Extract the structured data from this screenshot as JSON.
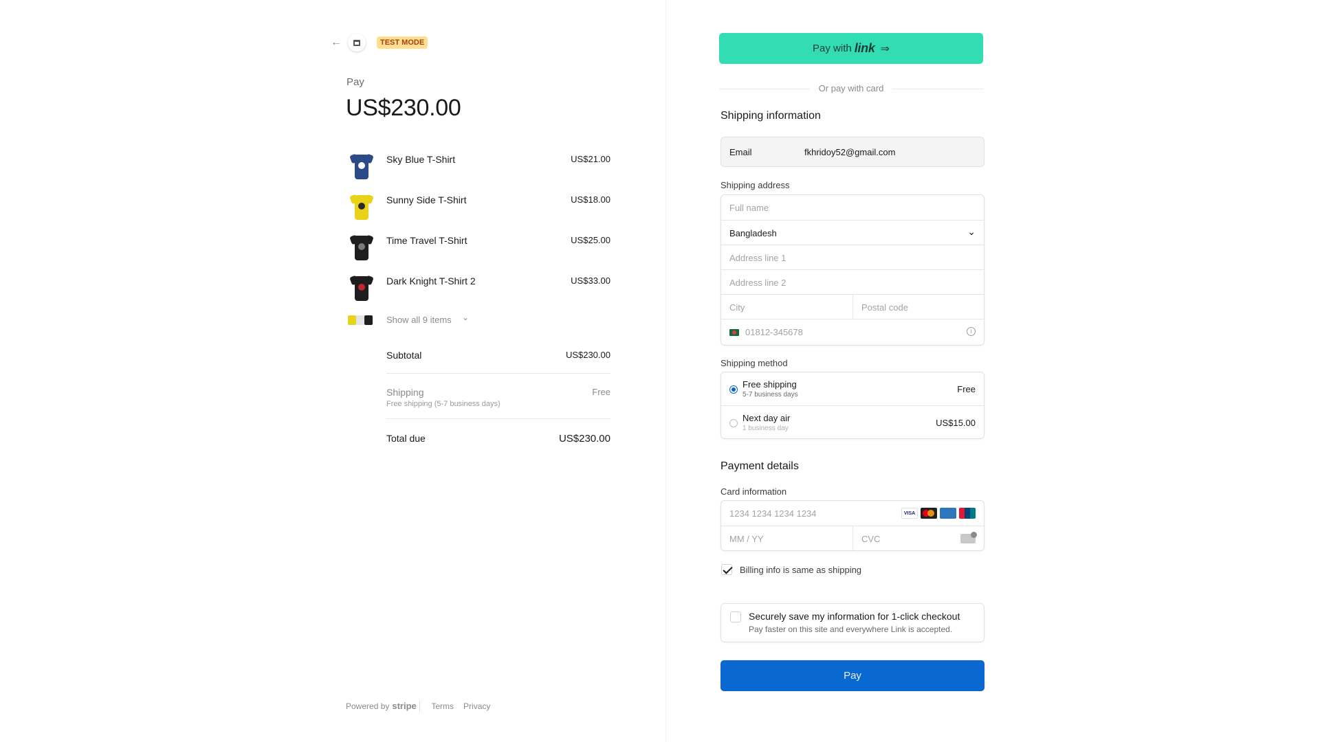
{
  "header": {
    "back_icon": "arrow-left-icon",
    "store_icon": "store-icon",
    "test_badge": "TEST MODE"
  },
  "summary": {
    "pay_label": "Pay",
    "amount": "US$230.00",
    "items": [
      {
        "name": "Sky Blue T-Shirt",
        "price": "US$21.00",
        "color": "#2c4a8a",
        "print": "#ffffff"
      },
      {
        "name": "Sunny Side T-Shirt",
        "price": "US$18.00",
        "color": "#e8d21a",
        "print": "#2a2a2a"
      },
      {
        "name": "Time Travel T-Shirt",
        "price": "US$25.00",
        "color": "#1e1e1e",
        "print": "#7a7a7a"
      },
      {
        "name": "Dark Knight T-Shirt 2",
        "price": "US$33.00",
        "color": "#1e1e1e",
        "print": "#c0282d"
      }
    ],
    "show_all": "Show all 9 items",
    "subtotal_label": "Subtotal",
    "subtotal_value": "US$230.00",
    "shipping_label": "Shipping",
    "shipping_sub": "Free shipping (5-7 business days)",
    "shipping_value": "Free",
    "total_label": "Total due",
    "total_value": "US$230.00"
  },
  "footer": {
    "powered_by": "Powered by",
    "brand": "stripe",
    "terms": "Terms",
    "privacy": "Privacy"
  },
  "checkout": {
    "link_button_prefix": "Pay with",
    "link_button_brand": "link",
    "or_text": "Or pay with card",
    "shipping_info_title": "Shipping information",
    "email_label": "Email",
    "email_value": "fkhridoy52@gmail.com",
    "shipping_address_label": "Shipping address",
    "full_name_placeholder": "Full name",
    "country_value": "Bangladesh",
    "address1_placeholder": "Address line 1",
    "address2_placeholder": "Address line 2",
    "city_placeholder": "City",
    "postal_placeholder": "Postal code",
    "phone_placeholder": "01812-345678",
    "shipping_method_label": "Shipping method",
    "shipping_methods": [
      {
        "title": "Free shipping",
        "sub": "5-7 business days",
        "price": "Free",
        "selected": true
      },
      {
        "title": "Next day air",
        "sub": "1 business day",
        "price": "US$15.00",
        "selected": false
      }
    ],
    "payment_details_title": "Payment details",
    "card_info_label": "Card information",
    "card_number_placeholder": "1234 1234 1234 1234",
    "expiry_placeholder": "MM / YY",
    "cvc_placeholder": "CVC",
    "card_brands": [
      "VISA",
      "MC",
      "AMEX",
      "UP"
    ],
    "billing_same_label": "Billing info is same as shipping",
    "billing_same_checked": true,
    "save_title": "Securely save my information for 1-click checkout",
    "save_sub": "Pay faster on this site and everywhere Link is accepted.",
    "pay_button": "Pay"
  },
  "colors": {
    "link_green": "#33ddb3",
    "pay_blue": "#0a68d1",
    "test_badge_bg": "#ffde92",
    "test_badge_text": "#a3410f"
  }
}
